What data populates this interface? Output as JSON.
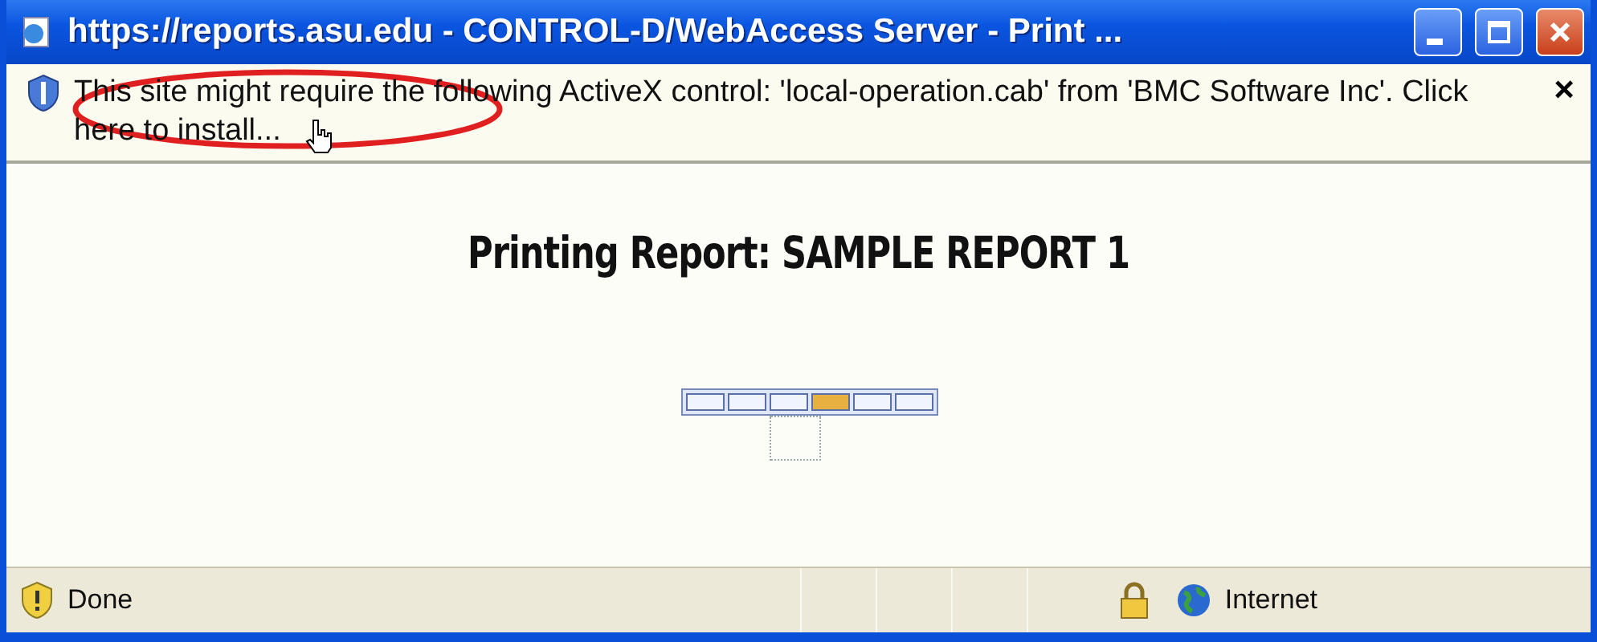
{
  "window": {
    "title": "https://reports.asu.edu - CONTROL-D/WebAccess Server - Print ..."
  },
  "info_bar": {
    "message": "This site might require the following ActiveX control: 'local-operation.cab' from 'BMC Software Inc'. Click here to install...",
    "close": "×"
  },
  "content": {
    "heading": "Printing Report: SAMPLE REPORT 1",
    "progress_segments": [
      {
        "active": false
      },
      {
        "active": false
      },
      {
        "active": false
      },
      {
        "active": true
      },
      {
        "active": false
      },
      {
        "active": false
      }
    ]
  },
  "status_bar": {
    "status": "Done",
    "zone": "Internet"
  }
}
